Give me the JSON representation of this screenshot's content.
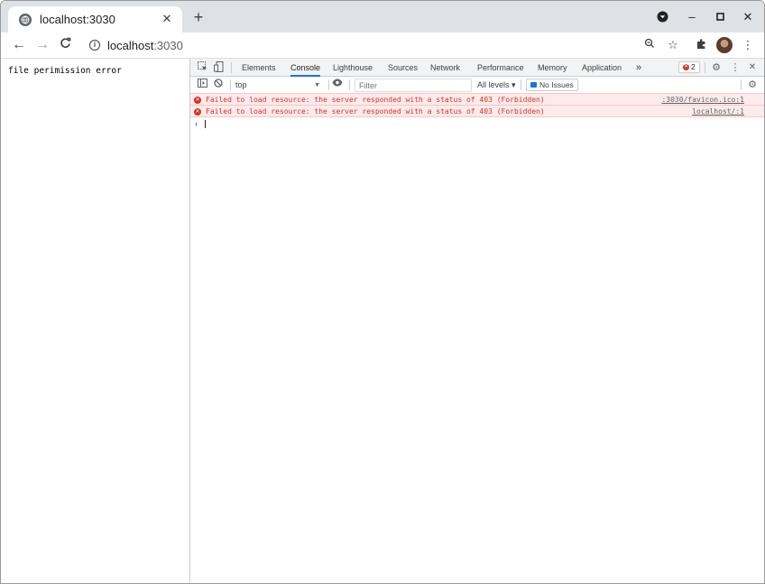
{
  "browser": {
    "tab": {
      "title": "localhost:3030",
      "close_label": "✕",
      "favicon": "globe-icon"
    },
    "new_tab_label": "+",
    "window_controls": {
      "profile": "▾",
      "minimize": "–",
      "maximize": "▫",
      "close": "✕"
    },
    "toolbar": {
      "back": "←",
      "forward": "→",
      "reload": "C",
      "url_host": "localhost",
      "url_port": ":3030",
      "zoom": "⌕",
      "star": "☆",
      "extensions": "✚",
      "menu": "⋮"
    }
  },
  "page": {
    "text": "file perimission error"
  },
  "devtools": {
    "tabs": [
      "Elements",
      "Console",
      "Lighthouse",
      "Sources",
      "Network",
      "Performance",
      "Memory",
      "Application"
    ],
    "active_tab": "Console",
    "more_tabs": "»",
    "error_count": "2",
    "settings": "⚙",
    "menu": "⋮",
    "close": "✕",
    "filterbar": {
      "context": "top",
      "context_arrow": "▼",
      "filter_placeholder": "Filter",
      "levels": "All levels ▾",
      "issues": "No Issues"
    },
    "messages": [
      {
        "text": "Failed to load resource: the server responded with a status of 403 (Forbidden)",
        "source": ":3030/favicon.ico:1"
      },
      {
        "text": "Failed to load resource: the server responded with a status of 403 (Forbidden)",
        "source": "localhost/:1"
      }
    ],
    "prompt": "›",
    "colors": {
      "error": "#d93025",
      "accent": "#1a73e8",
      "error_bg": "#fcebeb"
    }
  }
}
